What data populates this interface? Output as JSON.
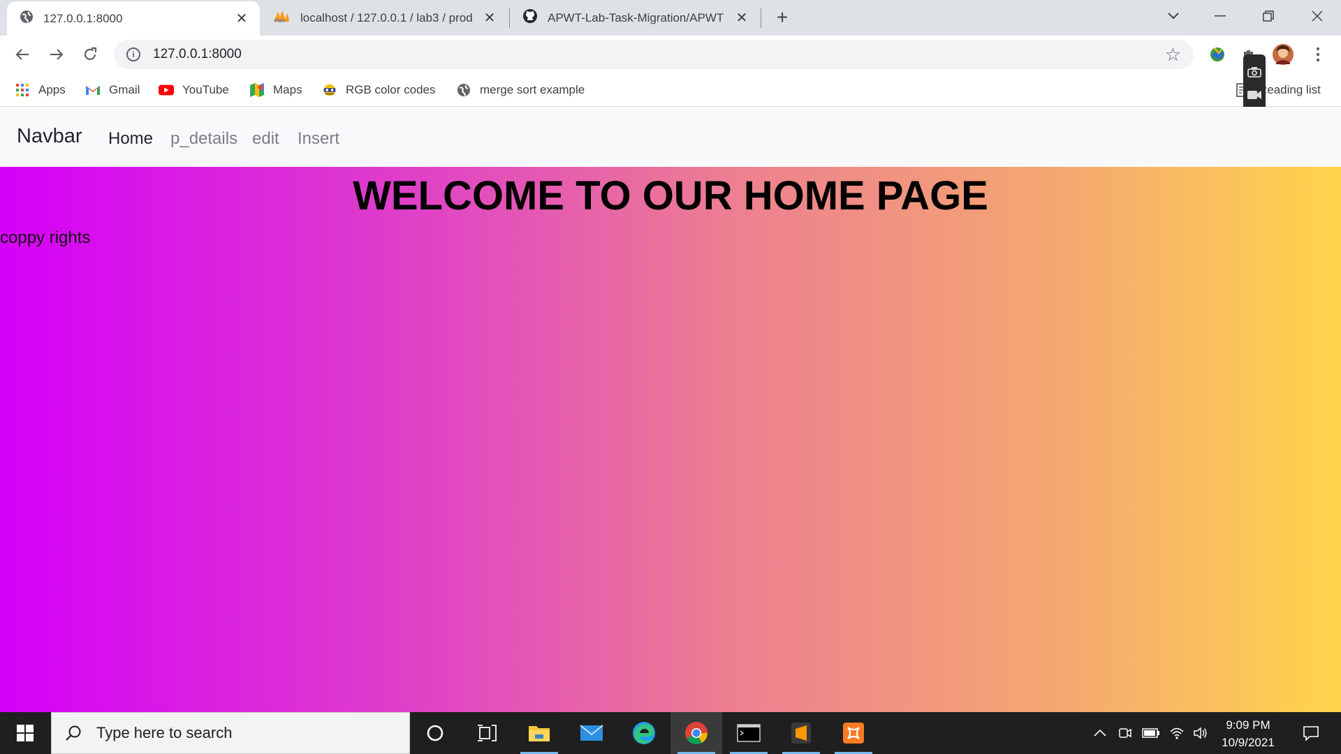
{
  "browser": {
    "tabs": [
      {
        "title": "127.0.0.1:8000",
        "active": true,
        "icon": "globe-icon"
      },
      {
        "title": "localhost / 127.0.0.1 / lab3 / prod",
        "active": false,
        "icon": "phpmyadmin-icon"
      },
      {
        "title": "APWT-Lab-Task-Migration/APWT",
        "active": false,
        "icon": "github-icon"
      }
    ],
    "new_tab": "+",
    "address": {
      "url": "127.0.0.1:8000"
    },
    "bookmarks": [
      {
        "label": "Apps",
        "icon": "apps-grid-icon"
      },
      {
        "label": "Gmail",
        "icon": "gmail-icon"
      },
      {
        "label": "YouTube",
        "icon": "youtube-icon"
      },
      {
        "label": "Maps",
        "icon": "maps-icon"
      },
      {
        "label": "RGB color codes",
        "icon": "rgb-icon"
      },
      {
        "label": "merge sort example",
        "icon": "globe-icon"
      }
    ],
    "reading_list": "Reading list"
  },
  "site": {
    "brand": "Navbar",
    "nav": [
      {
        "label": "Home",
        "active": true
      },
      {
        "label": "p_details",
        "active": false
      },
      {
        "label": "edit",
        "active": false
      },
      {
        "label": "Insert",
        "active": false
      }
    ],
    "heading": "WELCOME TO OUR HOME PAGE",
    "footer_text": "coppy rights",
    "gradient": [
      "#d500f9",
      "#ffd54c"
    ]
  },
  "taskbar": {
    "search_placeholder": "Type here to search",
    "apps": [
      "cortana-icon",
      "task-view-icon",
      "file-explorer-icon",
      "mail-icon",
      "edge-icon",
      "chrome-icon",
      "terminal-icon",
      "sublime-text-icon",
      "xampp-icon"
    ],
    "time": "9:09 PM",
    "date": "10/9/2021"
  },
  "colors": {
    "accent": "#1a73e8",
    "taskbar": "#1f1f1f",
    "tabstrip": "#dee1e6"
  }
}
